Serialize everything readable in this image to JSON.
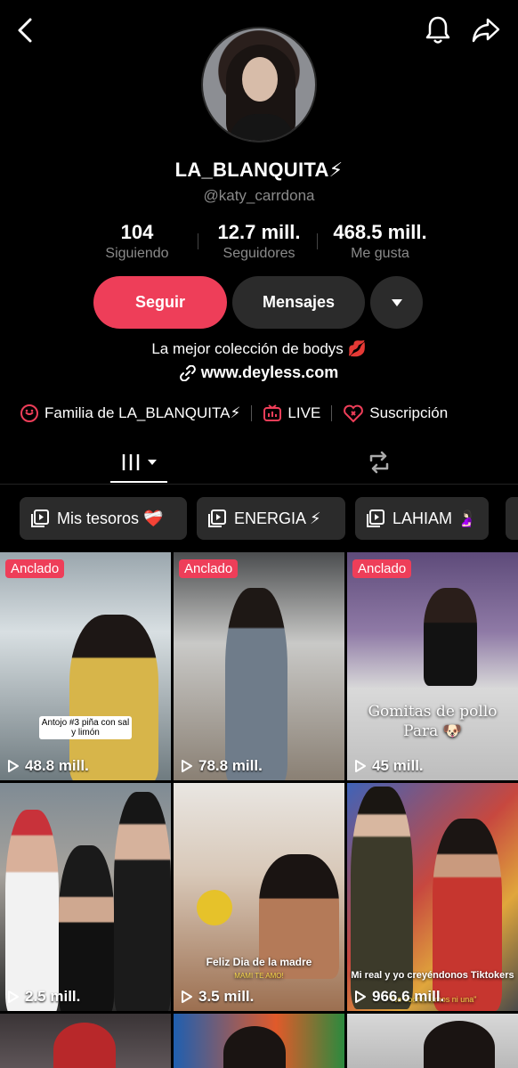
{
  "profile": {
    "username": "LA_BLANQUITA⚡",
    "handle": "@katy_carrdona",
    "bio": "La mejor colección de bodys 💋",
    "link": "www.deyless.com"
  },
  "stats": [
    {
      "value": "104",
      "label": "Siguiendo"
    },
    {
      "value": "12.7 mill.",
      "label": "Seguidores"
    },
    {
      "value": "468.5 mill.",
      "label": "Me gusta"
    }
  ],
  "actions": {
    "follow": "Seguir",
    "message": "Mensajes"
  },
  "features": {
    "family": "Familia de LA_BLANQUITA⚡",
    "live": "LIVE",
    "subscription": "Suscripción"
  },
  "playlists": [
    {
      "label": "Mis tesoros ❤️‍🩹"
    },
    {
      "label": "ENERGIA ⚡"
    },
    {
      "label": "LAHIAM 🤰🏻"
    }
  ],
  "videos": [
    {
      "pinned": "Anclado",
      "views": "48.8 mill.",
      "caption": "Antojo #3  piña con sal y limón"
    },
    {
      "pinned": "Anclado",
      "views": "78.8 mill.",
      "caption": ""
    },
    {
      "pinned": "Anclado",
      "views": "45 mill.",
      "caption": "Gomitas de pollo Para 🐶"
    },
    {
      "pinned": "",
      "views": "2.5 mill.",
      "caption": ""
    },
    {
      "pinned": "",
      "views": "3.5 mill.",
      "caption": "Feliz Dia de la madre",
      "caption2": "MAMI TE AMO!"
    },
    {
      "pinned": "",
      "views": "966.6 mill.",
      "caption": "Mi real y yo creyéndonos Tiktokers",
      "caption2": "\"No coordinamos ni una\""
    }
  ],
  "colors": {
    "accent": "#ee3e59",
    "button_dark": "#2b2b2b",
    "muted": "#8a8a8a"
  }
}
